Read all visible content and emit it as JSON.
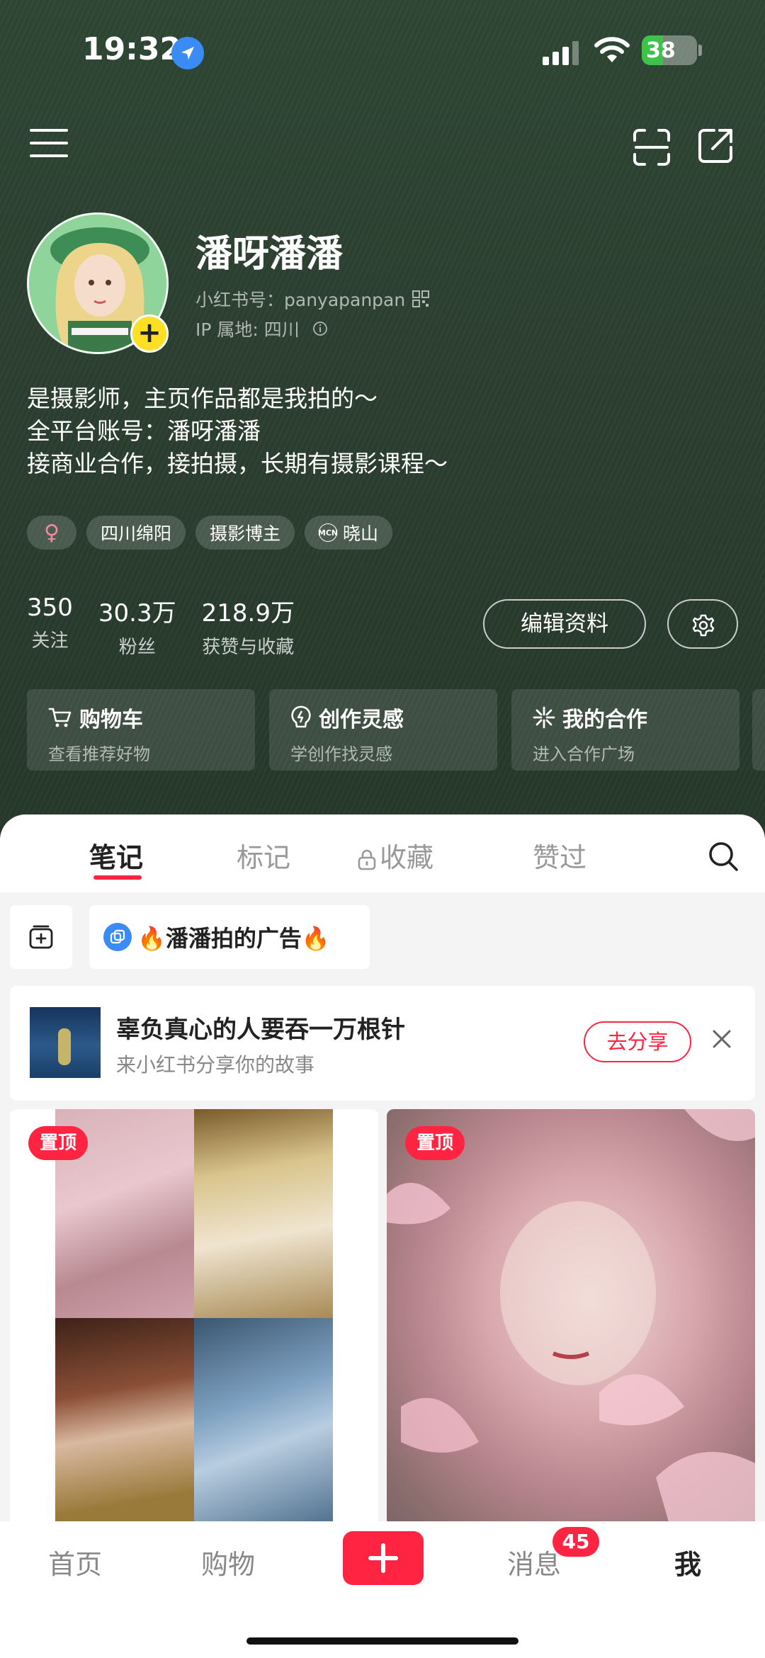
{
  "status_bar": {
    "time": "19:32",
    "battery": "38",
    "battery_level": 0.38,
    "icons": [
      "location-arrow-icon",
      "cellular-signal-icon",
      "wifi-icon",
      "battery-charging-icon"
    ]
  },
  "top_nav": {
    "icons": [
      "menu-icon",
      "scan-icon",
      "share-icon"
    ]
  },
  "profile": {
    "name": "潘呀潘潘",
    "id_label": "小红书号：panyapanpan",
    "ip_label": "IP 属地: 四川",
    "avatar_add": "+",
    "bio": [
      "是摄影师，主页作品都是我拍的～",
      "全平台账号：潘呀潘潘",
      "接商业合作，接拍摄，长期有摄影课程～"
    ],
    "tags": {
      "gender": "♀",
      "location": "四川绵阳",
      "category": "摄影博主",
      "mcn_badge": "MCN",
      "mcn_name": "晓山"
    },
    "stats": [
      {
        "value": "350",
        "label": "关注"
      },
      {
        "value": "30.3万",
        "label": "粉丝"
      },
      {
        "value": "218.9万",
        "label": "获赞与收藏"
      }
    ],
    "edit_label": "编辑资料"
  },
  "feature_cards": [
    {
      "title": "购物车",
      "subtitle": "查看推荐好物",
      "icon": "cart-icon"
    },
    {
      "title": "创作灵感",
      "subtitle": "学创作找灵感",
      "icon": "lightbulb-icon"
    },
    {
      "title": "我的合作",
      "subtitle": "进入合作广场",
      "icon": "sparkle-icon"
    }
  ],
  "content_tabs": [
    "笔记",
    "标记",
    "收藏",
    "赞过"
  ],
  "collection": {
    "label": "🔥潘潘拍的广告🔥"
  },
  "promo": {
    "title": "辜负真心的人要吞一万根针",
    "subtitle": "来小红书分享你的故事",
    "button": "去分享"
  },
  "posts": [
    {
      "badge": "置顶"
    },
    {
      "badge": "置顶"
    }
  ],
  "bottom_nav": {
    "items": [
      "首页",
      "购物",
      "消息",
      "我"
    ],
    "message_badge": "45"
  },
  "colors": {
    "header_bg": "#2c3f30",
    "accent": "#ff2442",
    "avatar_add": "#fde024",
    "battery": "#3ec24a"
  }
}
